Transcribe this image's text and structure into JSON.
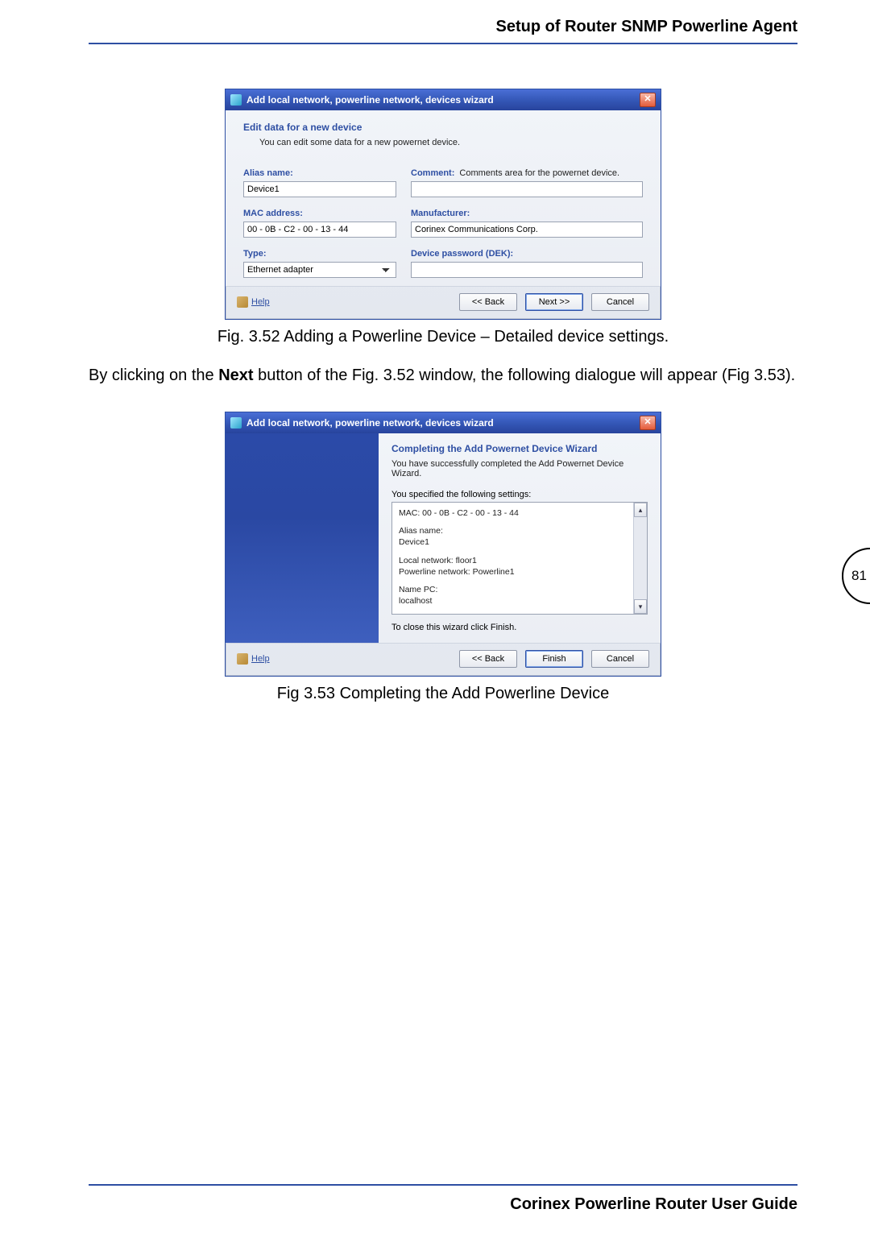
{
  "page": {
    "header_title": "Setup of Router SNMP Powerline Agent",
    "footer_title": "Corinex Powerline Router User Guide",
    "page_number": "81"
  },
  "fig352_caption": "Fig. 3.52 Adding a Powerline Device – Detailed device settings.",
  "body_paragraph_parts": {
    "p1": "By clicking on the ",
    "p2": "Next",
    "p3": " button of the Fig. 3.52 window, the following dialogue will appear (Fig 3.53)."
  },
  "fig353_caption": "Fig 3.53 Completing the Add Powerline Device",
  "dialog1": {
    "title": "Add local network, powerline network, devices wizard",
    "close": "✕",
    "section_title": "Edit data for a new device",
    "section_sub": "You can edit some data for a new powernet device.",
    "labels": {
      "alias": "Alias name:",
      "comment": "Comment:",
      "comment_hint": "Comments area for the powernet device.",
      "mac": "MAC address:",
      "manufacturer": "Manufacturer:",
      "type": "Type:",
      "dek": "Device password (DEK):"
    },
    "values": {
      "alias": "Device1",
      "comment": "",
      "mac": "00 - 0B - C2 - 00 - 13 - 44",
      "manufacturer": "Corinex Communications Corp.",
      "type": "Ethernet adapter",
      "dek": ""
    },
    "footer": {
      "help": "Help",
      "back": "<< Back",
      "next": "Next >>",
      "cancel": "Cancel"
    }
  },
  "dialog2": {
    "title": "Add local network, powerline network, devices wizard",
    "close": "✕",
    "heading": "Completing the Add Powernet Device Wizard",
    "sub": "You have successfully completed the Add Powernet Device Wizard.",
    "settings_intro": "You specified the following settings:",
    "settings": {
      "mac_line": "MAC: 00 - 0B - C2 - 00 - 13 - 44",
      "alias_label": "Alias name:",
      "alias_value": "Device1",
      "local_net": "Local network: floor1",
      "powerline_net": "Powerline network: Powerline1",
      "namepc_label": "Name PC:",
      "namepc_value": "localhost"
    },
    "close_instr": "To close this wizard click Finish.",
    "footer": {
      "help": "Help",
      "back": "<< Back",
      "finish": "Finish",
      "cancel": "Cancel"
    }
  }
}
